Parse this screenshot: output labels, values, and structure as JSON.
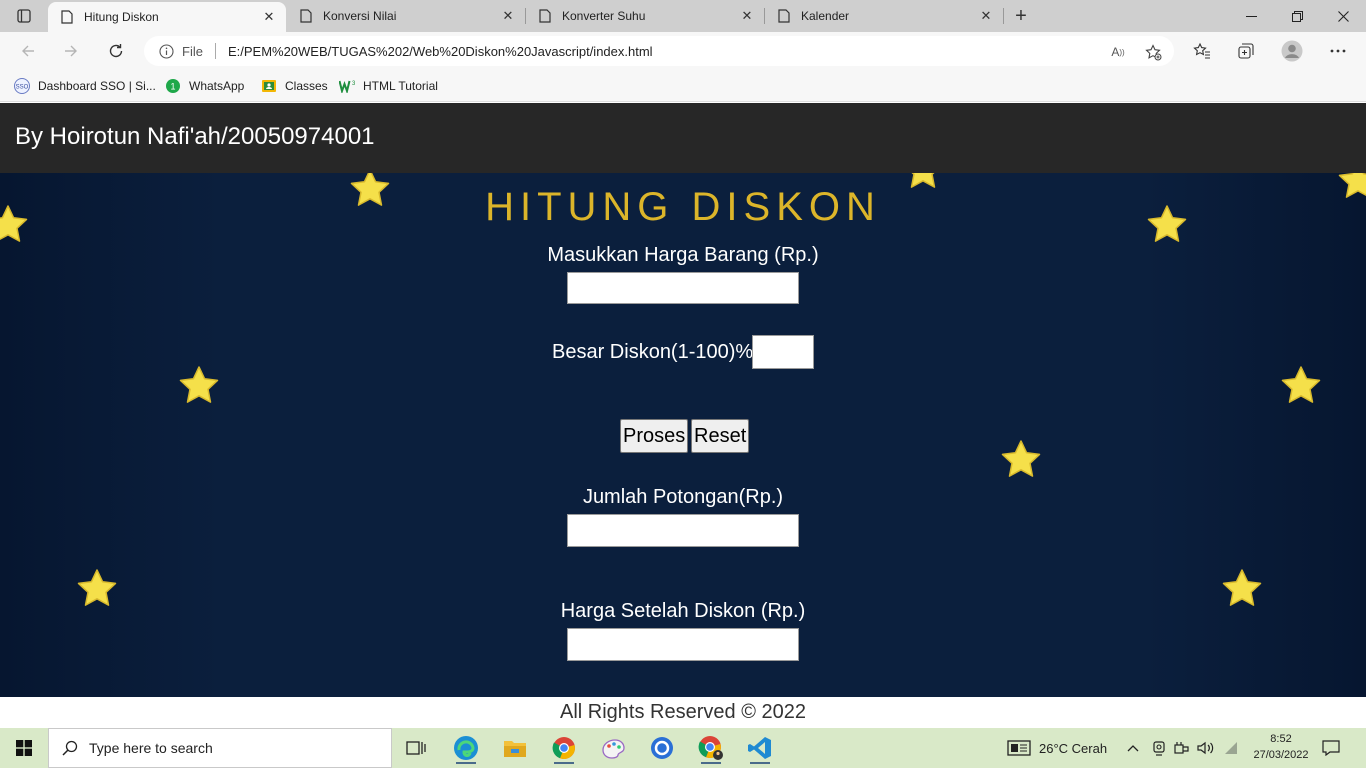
{
  "browser": {
    "tabs": [
      {
        "label": "Hitung Diskon",
        "active": true
      },
      {
        "label": "Konversi Nilai",
        "active": false
      },
      {
        "label": "Konverter Suhu",
        "active": false
      },
      {
        "label": "Kalender",
        "active": false
      }
    ],
    "address": {
      "scheme": "File",
      "url": "E:/PEM%20WEB/TUGAS%202/Web%20Diskon%20Javascript/index.html"
    },
    "bookmarks": [
      {
        "label": "Dashboard SSO | Si...",
        "icon": "sso-logo-icon"
      },
      {
        "label": "WhatsApp",
        "icon": "whatsapp-icon",
        "badge": "1"
      },
      {
        "label": "Classes",
        "icon": "classroom-icon"
      },
      {
        "label": "HTML Tutorial",
        "icon": "w3schools-icon"
      }
    ]
  },
  "page": {
    "header_title": "By Hoirotun Nafi'ah/20050974001",
    "title": "HITUNG DISKON",
    "harga_label": "Masukkan Harga Barang (Rp.)",
    "harga_value": "",
    "diskon_label": "Besar Diskon(1-100)%",
    "diskon_value": "",
    "proses_label": "Proses",
    "reset_label": "Reset",
    "potongan_label": "Jumlah Potongan(Rp.)",
    "potongan_value": "",
    "hasil_label": "Harga Setelah Diskon (Rp.)",
    "hasil_value": "",
    "footer": "All Rights Reserved © 2022"
  },
  "taskbar": {
    "search_placeholder": "Type here to search",
    "apps": [
      "task-view-icon",
      "edge-icon",
      "file-explorer-icon",
      "chrome-icon",
      "paint-icon",
      "cortana-icon",
      "chrome-profile-icon",
      "vscode-icon"
    ],
    "weather": "26°C  Cerah",
    "time": "8:52",
    "date": "27/03/2022"
  },
  "colors": {
    "title_gold": "#dcb52a",
    "stage_bg": "#0b1f3d",
    "header_bg": "#272727",
    "star_yellow": "#f5e04a",
    "taskbar_bg": "#d9e9c8"
  }
}
